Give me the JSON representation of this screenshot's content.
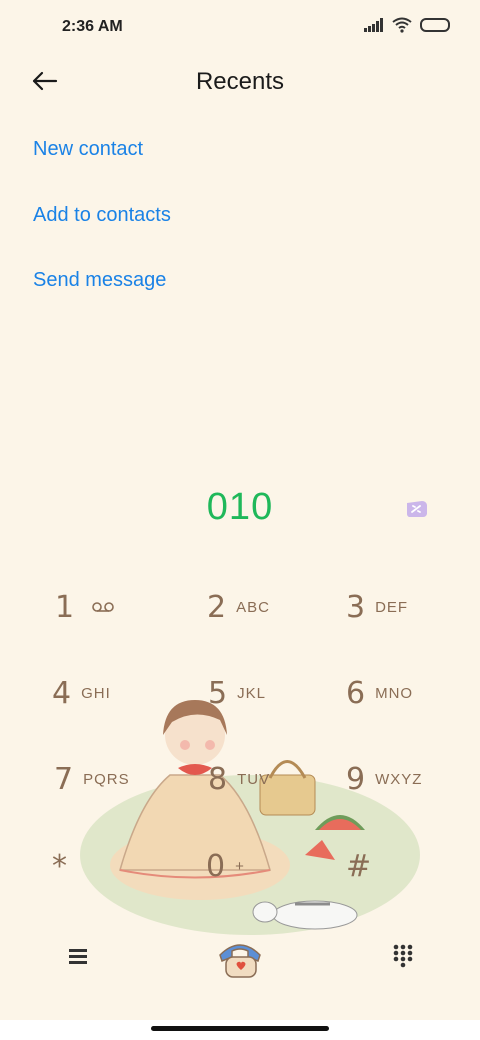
{
  "status_bar": {
    "time": "2:36 AM"
  },
  "header": {
    "title": "Recents"
  },
  "actions": [
    {
      "label": "New contact"
    },
    {
      "label": "Add to contacts"
    },
    {
      "label": "Send message"
    }
  ],
  "dialer": {
    "number": "010",
    "keys": [
      {
        "digit": "1",
        "letters": ""
      },
      {
        "digit": "2",
        "letters": "ABC"
      },
      {
        "digit": "3",
        "letters": "DEF"
      },
      {
        "digit": "4",
        "letters": "GHI"
      },
      {
        "digit": "5",
        "letters": "JKL"
      },
      {
        "digit": "6",
        "letters": "MNO"
      },
      {
        "digit": "7",
        "letters": "PQRS"
      },
      {
        "digit": "8",
        "letters": "TUV"
      },
      {
        "digit": "9",
        "letters": "WXYZ"
      },
      {
        "digit": "*",
        "letters": ""
      },
      {
        "digit": "0",
        "letters": "+"
      },
      {
        "digit": "#",
        "letters": ""
      }
    ]
  },
  "colors": {
    "background": "#fcf5e8",
    "link": "#1a82e6",
    "number": "#1fb85a",
    "key": "#8a6d55"
  },
  "icons": {
    "back": "arrow-left-icon",
    "menu": "menu-icon",
    "call": "call-icon",
    "keypad": "dialpad-icon",
    "voicemail": "voicemail-icon",
    "sim": "sim-card-icon"
  }
}
